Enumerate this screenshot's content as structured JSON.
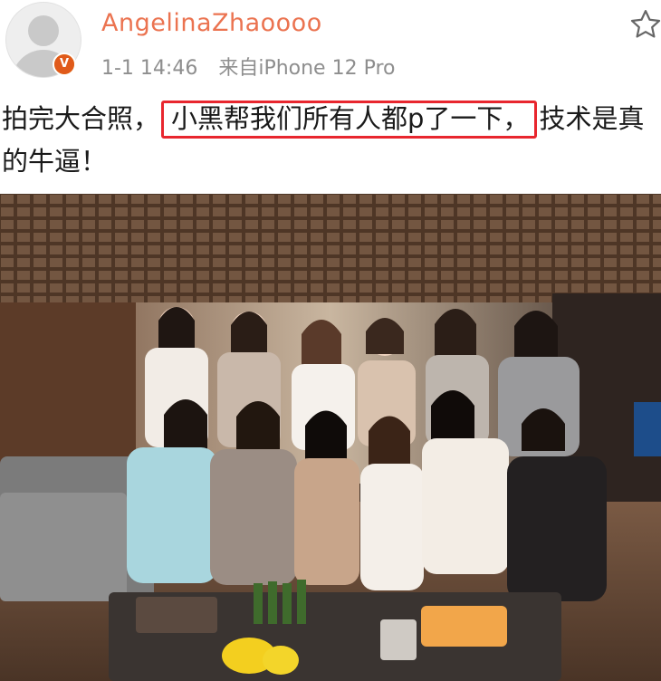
{
  "post": {
    "author": {
      "name": "AngelinaZhaoooo",
      "avatar_icon": "default-avatar-icon",
      "badge_icon": "verified-v-icon",
      "badge_letter": "V"
    },
    "meta": {
      "time": "1-1 14:46",
      "source": "来自iPhone 12 Pro"
    },
    "actions": {
      "favorite_icon": "star-outline-icon"
    },
    "text": {
      "before": "拍完大合照，",
      "highlighted": "小黑帮我们所有人都p了一下，",
      "after": "技术是真的牛逼！"
    },
    "colors": {
      "username": "#eb7350",
      "meta": "#8e8e8e",
      "highlight_border": "#e8262e",
      "badge": "#e05a1b"
    }
  }
}
